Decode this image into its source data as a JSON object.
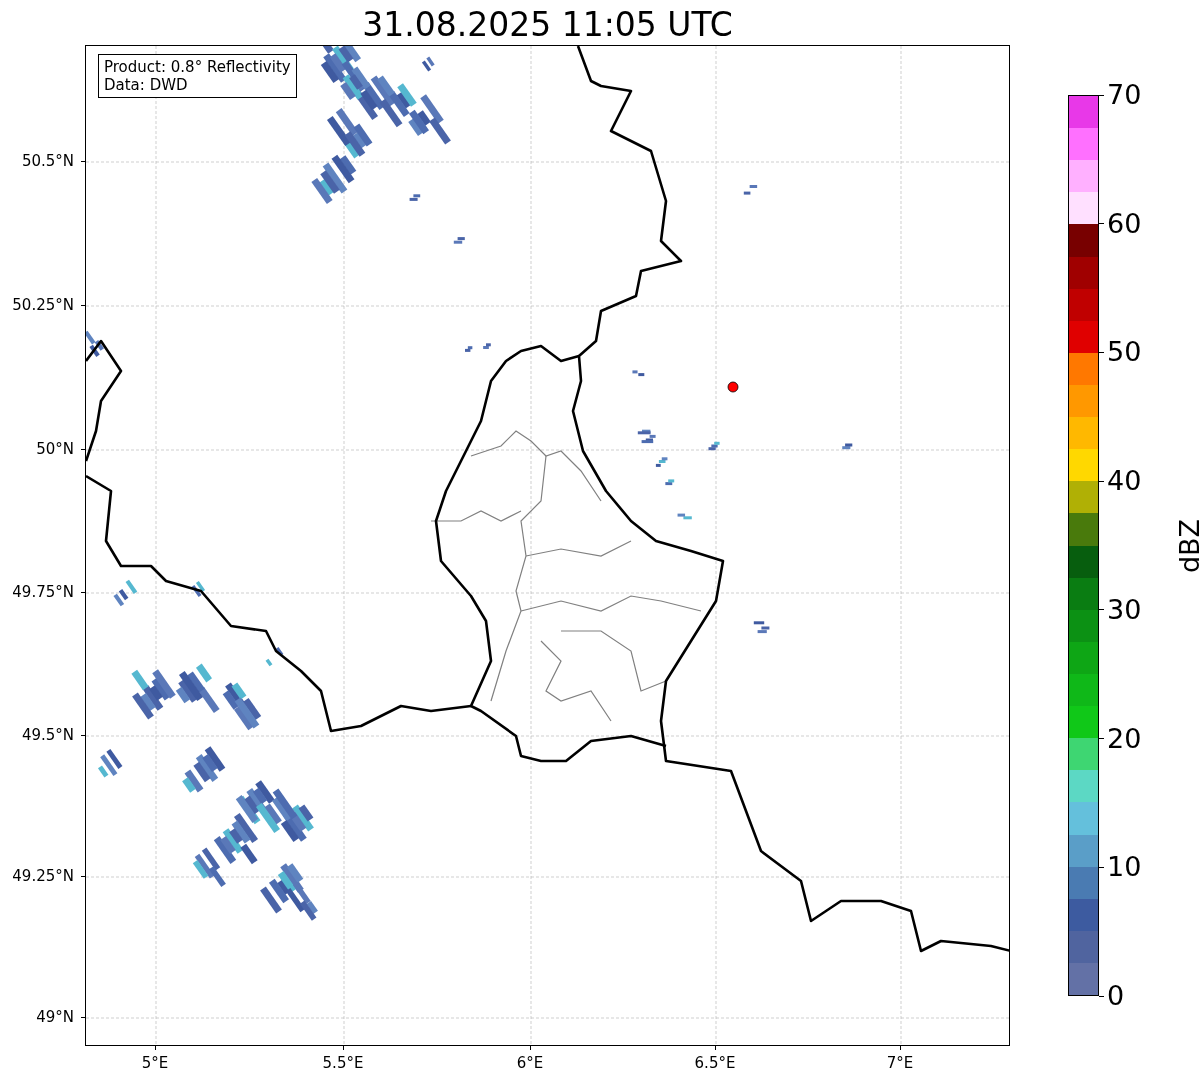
{
  "title": "31.08.2025 11:05 UTC",
  "info_box": {
    "lines": [
      "Product: 0.8° Reflectivity",
      "Data: DWD"
    ]
  },
  "y_ticks": [
    {
      "label": "50.5°N"
    },
    {
      "label": "50.25°N"
    },
    {
      "label": "50°N"
    },
    {
      "label": "49.75°N"
    },
    {
      "label": "49.5°N"
    },
    {
      "label": "49.25°N"
    },
    {
      "label": "49°N"
    }
  ],
  "x_ticks": [
    {
      "label": "5°E"
    },
    {
      "label": "5.5°E"
    },
    {
      "label": "6°E"
    },
    {
      "label": "6.5°E"
    },
    {
      "label": "7°E"
    }
  ],
  "colorbar": {
    "label": "dBZ",
    "segments": [
      {
        "color": "#e838e8"
      },
      {
        "color": "#ff70ff"
      },
      {
        "color": "#ffb0ff"
      },
      {
        "color": "#ffe0ff"
      },
      {
        "color": "#780000"
      },
      {
        "color": "#a00000"
      },
      {
        "color": "#c00000"
      },
      {
        "color": "#e00000"
      },
      {
        "color": "#ff7800"
      },
      {
        "color": "#ff9800"
      },
      {
        "color": "#ffb800"
      },
      {
        "color": "#ffd800"
      },
      {
        "color": "#b0b005"
      },
      {
        "color": "#497a0c"
      },
      {
        "color": "#075e0e"
      },
      {
        "color": "#0a7d12"
      },
      {
        "color": "#0c9114"
      },
      {
        "color": "#0ea615"
      },
      {
        "color": "#0fb818"
      },
      {
        "color": "#10c818"
      },
      {
        "color": "#3ed672"
      },
      {
        "color": "#5cd8c4"
      },
      {
        "color": "#64c0dc"
      },
      {
        "color": "#5a9ec8"
      },
      {
        "color": "#4a7bb2"
      },
      {
        "color": "#3d5ba0"
      },
      {
        "color": "#50649f"
      },
      {
        "color": "#6371a6"
      }
    ],
    "ticks": [
      "70",
      "60",
      "50",
      "40",
      "30",
      "20",
      "10",
      "0"
    ]
  }
}
